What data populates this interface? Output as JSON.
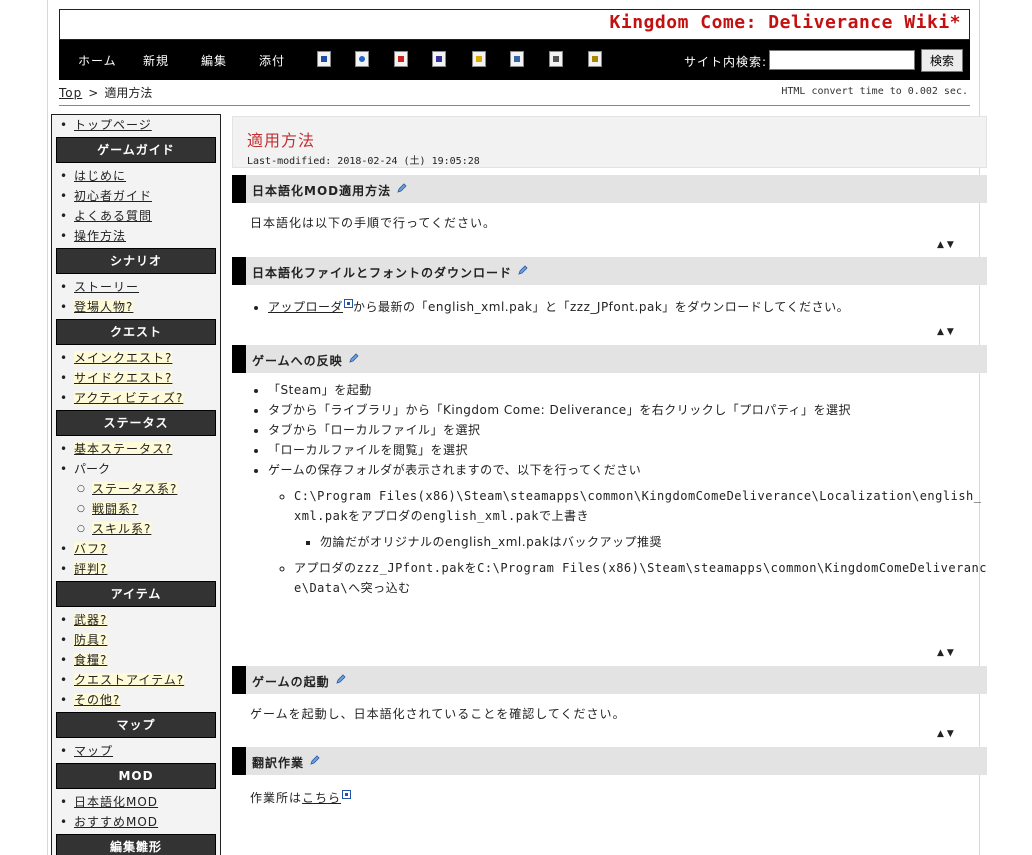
{
  "site": {
    "title": "Kingdom Come: Deliverance Wiki*"
  },
  "nav": {
    "links": [
      "ホーム",
      "新規",
      "編集",
      "添付"
    ],
    "icons": [
      "list-icon",
      "search-page-icon",
      "diff-icon",
      "backup-icon",
      "lock-icon",
      "copy-icon",
      "rss-icon",
      "help-icon"
    ],
    "search_label": "サイト内検索:",
    "search_value": "",
    "search_button": "検索"
  },
  "breadcrumb": {
    "top": "Top",
    "separator": ">",
    "current": "適用方法"
  },
  "convert_time": "HTML convert time to 0.002 sec.",
  "sidebar": {
    "top_link": "トップページ",
    "groups": [
      {
        "head": "ゲームガイド",
        "items": [
          {
            "label": "はじめに"
          },
          {
            "label": "初心者ガイド"
          },
          {
            "label": "よくある質問"
          },
          {
            "label": "操作方法"
          }
        ]
      },
      {
        "head": "シナリオ",
        "items": [
          {
            "label": "ストーリー"
          },
          {
            "label": "登場人物?",
            "wanted": true
          }
        ]
      },
      {
        "head": "クエスト",
        "items": [
          {
            "label": "メインクエスト?",
            "wanted": true
          },
          {
            "label": "サイドクエスト?",
            "wanted": true
          },
          {
            "label": "アクティビティズ?",
            "wanted": true
          }
        ]
      },
      {
        "head": "ステータス",
        "items": [
          {
            "label": "基本ステータス?",
            "wanted": true
          },
          {
            "label": "パーク",
            "plain": true
          },
          {
            "label": "ステータス系?",
            "wanted": true,
            "sub": true
          },
          {
            "label": "戦闘系?",
            "wanted": true,
            "sub": true
          },
          {
            "label": "スキル系?",
            "wanted": true,
            "sub": true
          },
          {
            "label": "バフ?",
            "wanted": true
          },
          {
            "label": "評判?",
            "wanted": true
          }
        ]
      },
      {
        "head": "アイテム",
        "items": [
          {
            "label": "武器?",
            "wanted": true
          },
          {
            "label": "防具?",
            "wanted": true
          },
          {
            "label": "食糧?",
            "wanted": true
          },
          {
            "label": "クエストアイテム?",
            "wanted": true
          },
          {
            "label": "その他?",
            "wanted": true
          }
        ]
      },
      {
        "head": "マップ",
        "items": [
          {
            "label": "マップ"
          }
        ]
      },
      {
        "head": "MOD",
        "items": [
          {
            "label": "日本語化MOD"
          },
          {
            "label": "おすすめMOD"
          }
        ]
      },
      {
        "head": "編集雛形",
        "items": []
      }
    ]
  },
  "page": {
    "title": "適用方法",
    "last_modified": "Last-modified: 2018-02-24 (土) 19:05:28"
  },
  "sections": {
    "s1": {
      "title": "日本語化MOD適用方法",
      "text": "日本語化は以下の手順で行ってください。"
    },
    "s2": {
      "title": "日本語化ファイルとフォントのダウンロード",
      "link": "アップローダ",
      "text": "から最新の「english_xml.pak」と「zzz_JPfont.pak」をダウンロードしてください。"
    },
    "s3": {
      "title": "ゲームへの反映",
      "steps": [
        "「Steam」を起動",
        "タブから「ライブラリ」から「Kingdom Come: Deliverance」を右クリックし「プロパティ」を選択",
        "タブから「ローカルファイル」を選択",
        "「ローカルファイルを閲覧」を選択",
        "ゲームの保存フォルダが表示されますので、以下を行ってください"
      ],
      "sub1": "C:\\Program Files(x86)\\Steam\\steamapps\\common\\KingdomComeDeliverance\\Localization\\english_xml.pakをアプロダのenglish_xml.pakで上書き",
      "sub1_note": "勿論だがオリジナルのenglish_xml.pakはバックアップ推奨",
      "sub2": "アプロダのzzz_JPfont.pakをC:\\Program Files(x86)\\Steam\\steamapps\\common\\KingdomComeDeliverance\\Data\\へ突っ込む"
    },
    "s4": {
      "title": "ゲームの起動",
      "text": "ゲームを起動し、日本語化されていることを確認してください。"
    },
    "s5": {
      "title": "翻訳作業",
      "text": "作業所は",
      "link": "こちら"
    }
  },
  "arrows": {
    "up": "▲",
    "down": "▼"
  }
}
